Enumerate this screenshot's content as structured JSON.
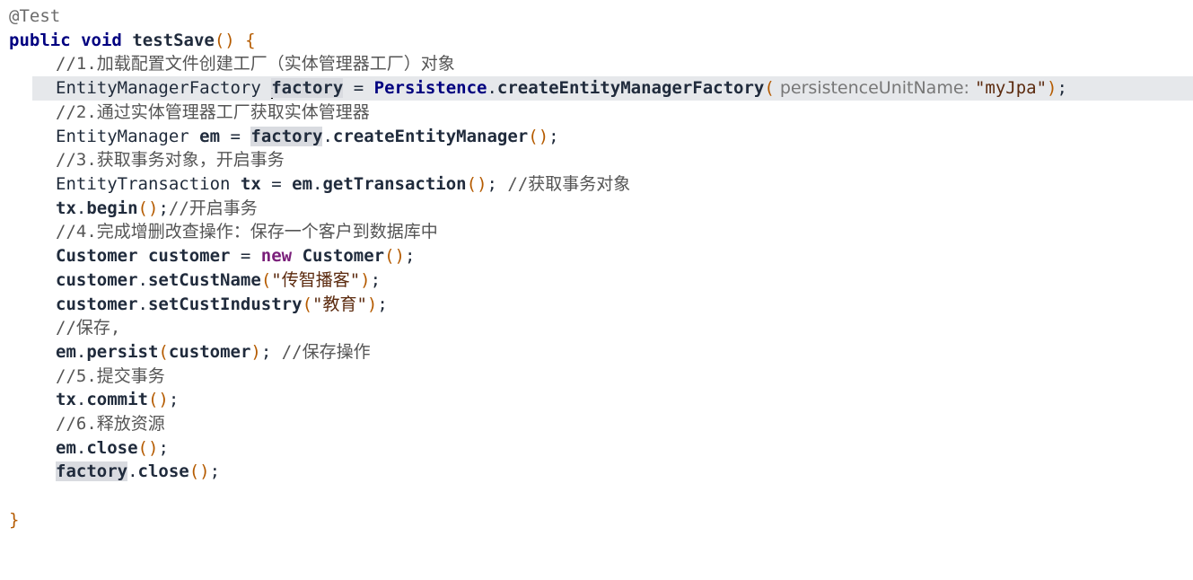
{
  "code": {
    "annotation": "@Test",
    "sig": {
      "pub": "public",
      "void": "void",
      "name": "testSave",
      "open": "(",
      "close": ")",
      "brace": " {"
    },
    "c1": "//1.加载配置文件创建工厂（实体管理器工厂）对象",
    "l2": {
      "type": "EntityManagerFactory ",
      "var": "factory",
      "eq": " = ",
      "cls": "Persistence",
      "dot": ".",
      "method": "createEntityManagerFactory",
      "open": "(",
      "hint": " persistenceUnitName: ",
      "str": "\"myJpa\"",
      "close": ")",
      "semi": ";"
    },
    "c2": "//2.通过实体管理器工厂获取实体管理器",
    "l3": {
      "type": "EntityManager ",
      "var": "em",
      "eq": " = ",
      "ref": "factory",
      "dot": ".",
      "method": "createEntityManager",
      "parens": "()",
      "semi": ";"
    },
    "c3": "//3.获取事务对象，开启事务",
    "l4": {
      "type": "EntityTransaction ",
      "var": "tx",
      "eq": " = ",
      "ref": "em",
      "dot": ".",
      "method": "getTransaction",
      "parens": "()",
      "semi": "; ",
      "comment": "//获取事务对象"
    },
    "l5": {
      "ref": "tx",
      "dot": ".",
      "method": "begin",
      "parens": "()",
      "semi": ";",
      "comment": "//开启事务"
    },
    "c4": "//4.完成增删改查操作：保存一个客户到数据库中",
    "l6": {
      "type": "Customer ",
      "var": "customer",
      "eq": " = ",
      "new": "new",
      "cls": " Customer",
      "parens": "()",
      "semi": ";"
    },
    "l7": {
      "ref": "customer",
      "dot": ".",
      "method": "setCustName",
      "open": "(",
      "str": "\"传智播客\"",
      "close": ")",
      "semi": ";"
    },
    "l8": {
      "ref": "customer",
      "dot": ".",
      "method": "setCustIndustry",
      "open": "(",
      "str": "\"教育\"",
      "close": ")",
      "semi": ";"
    },
    "c5": "//保存,",
    "l9": {
      "ref": "em",
      "dot": ".",
      "method": "persist",
      "open": "(",
      "arg": "customer",
      "close": ")",
      "semi": "; ",
      "comment": "//保存操作"
    },
    "c6": "//5.提交事务",
    "l10": {
      "ref": "tx",
      "dot": ".",
      "method": "commit",
      "parens": "()",
      "semi": ";"
    },
    "c7": "//6.释放资源",
    "l11": {
      "ref": "em",
      "dot": ".",
      "method": "close",
      "parens": "()",
      "semi": ";"
    },
    "l12": {
      "ref": "factory",
      "dot": ".",
      "method": "close",
      "parens": "()",
      "semi": ";"
    },
    "end": "}"
  },
  "colors": {
    "keyword": "#000080",
    "string": "#5b2a0e",
    "comment": "#555555",
    "paren": "#b55b00",
    "current_line": "#e6e8eb",
    "usage_highlight": "#d9dbe0"
  }
}
